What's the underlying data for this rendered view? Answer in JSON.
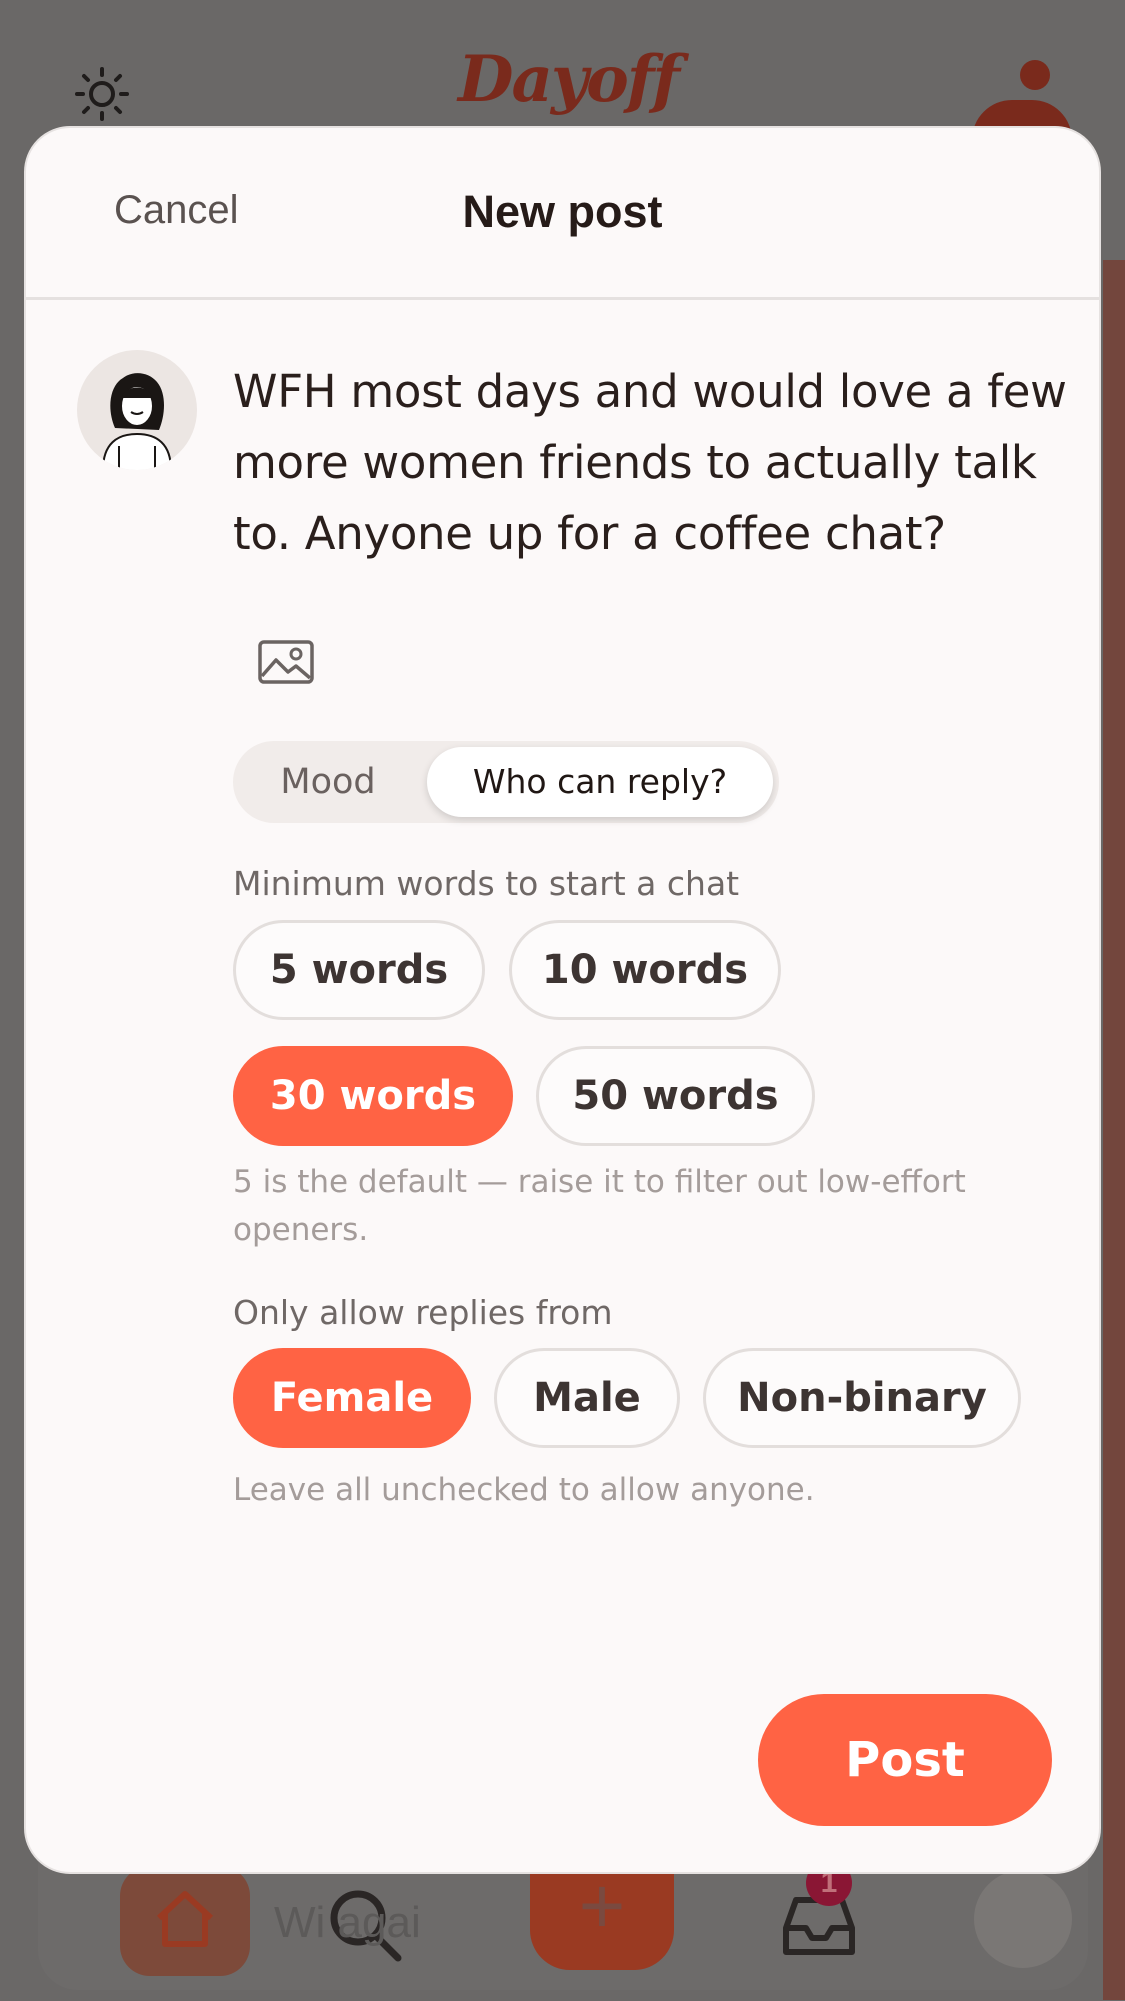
{
  "background": {
    "logo_text": "Dayoff",
    "search_text": "Wi    agai",
    "plus_label": "+",
    "inbox_badge": "1"
  },
  "modal": {
    "cancel_label": "Cancel",
    "title": "New post",
    "post_text": "WFH most days and would love a few more women friends to actually talk to. Anyone up for a coffee chat?",
    "tabs": {
      "mood": "Mood",
      "who": "Who can reply?",
      "selected": "Who can reply?"
    },
    "min_words": {
      "label": "Minimum words to start a chat",
      "options": [
        "5 words",
        "10 words",
        "30 words",
        "50 words"
      ],
      "selected": "30 words",
      "hint": "5 is the default — raise it to filter out low-effort openers."
    },
    "reply_from": {
      "label": "Only allow replies from",
      "options": [
        "Female",
        "Male",
        "Non-binary"
      ],
      "selected": [
        "Female"
      ],
      "hint": "Leave all unchecked to allow anyone."
    },
    "post_label": "Post"
  },
  "colors": {
    "accent": "#ff6344",
    "modal_bg": "#fcf9f9",
    "overlay": "#6a6867"
  }
}
